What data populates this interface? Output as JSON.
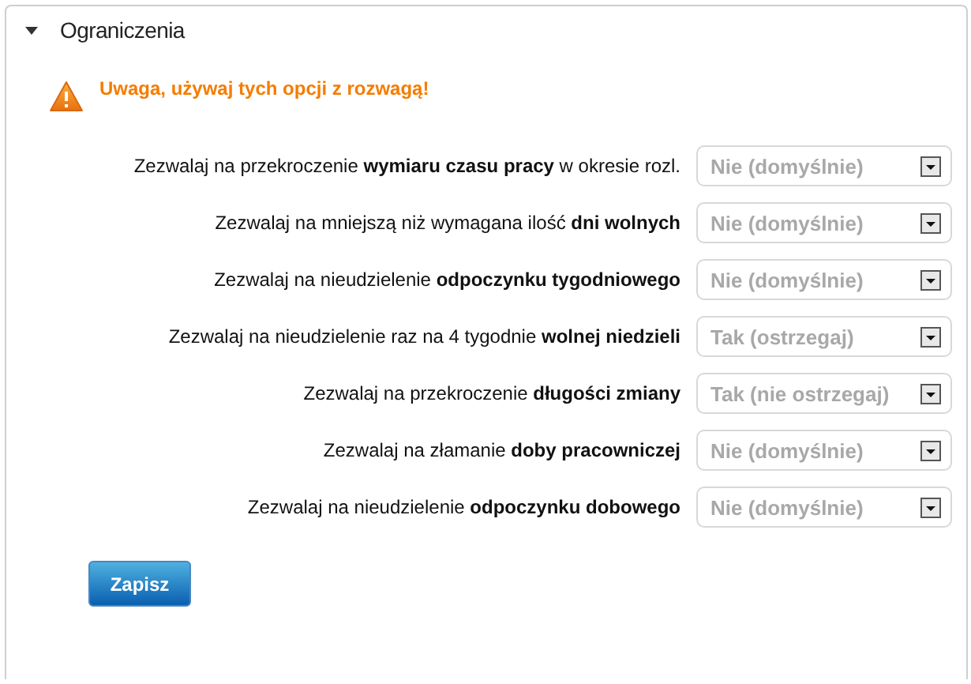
{
  "section": {
    "title": "Ograniczenia",
    "expanded": true
  },
  "warning": "Uwaga, używaj tych opcji z rozwagą!",
  "rows": [
    {
      "label": "Zezwalaj na przekroczenie **wymiaru czasu pracy** w okresie rozl.",
      "value": "Nie (domyślnie)"
    },
    {
      "label": "Zezwalaj na mniejszą niż wymagana ilość **dni wolnych**",
      "value": "Nie (domyślnie)"
    },
    {
      "label": "Zezwalaj na nieudzielenie **odpoczynku tygodniowego**",
      "value": "Nie (domyślnie)"
    },
    {
      "label": "Zezwalaj na nieudzielenie raz na 4 tygodnie **wolnej niedzieli**",
      "value": "Tak (ostrzegaj)"
    },
    {
      "label": "Zezwalaj na przekroczenie **długości zmiany**",
      "value": "Tak (nie ostrzegaj)"
    },
    {
      "label": "Zezwalaj na złamanie **doby pracowniczej**",
      "value": "Nie (domyślnie)"
    },
    {
      "label": "Zezwalaj na nieudzielenie **odpoczynku dobowego**",
      "value": "Nie (domyślnie)"
    }
  ],
  "save_button": "Zapisz"
}
